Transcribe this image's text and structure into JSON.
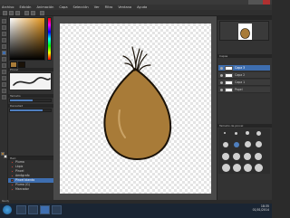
{
  "menubar": {
    "items": [
      "Archivo",
      "Edición",
      "Animación",
      "Capa",
      "Selección",
      "Ver",
      "Filtro",
      "Ventana",
      "Ayuda"
    ]
  },
  "left_panel": {
    "color_header": "Color",
    "brush_header": "Pincel",
    "size_label": "Tamaño",
    "density_label": "Densidad"
  },
  "sliders": {
    "size_fraction": 0.55,
    "density_fraction": 0.8
  },
  "tools_list": {
    "header": "Herr.",
    "items": [
      "Pluma",
      "Lápiz",
      "Pincel",
      "Aerógrafo",
      "Pincel blando",
      "Pluma (G)",
      "Marcador"
    ],
    "selected_index": 4
  },
  "layers": {
    "header": "Capas",
    "rows": [
      "Capa 3",
      "Capa 2",
      "Capa 1",
      "Papel"
    ],
    "selected_index": 0
  },
  "brush_panel": {
    "header": "Tamaño de pincel"
  },
  "status": {
    "text": "Ready"
  },
  "clock": {
    "time": "18:35",
    "date": "01/01/2014"
  },
  "colors": {
    "accent": "#3e6eb0",
    "fill": "#a87b38",
    "stroke": "#1a1208"
  }
}
